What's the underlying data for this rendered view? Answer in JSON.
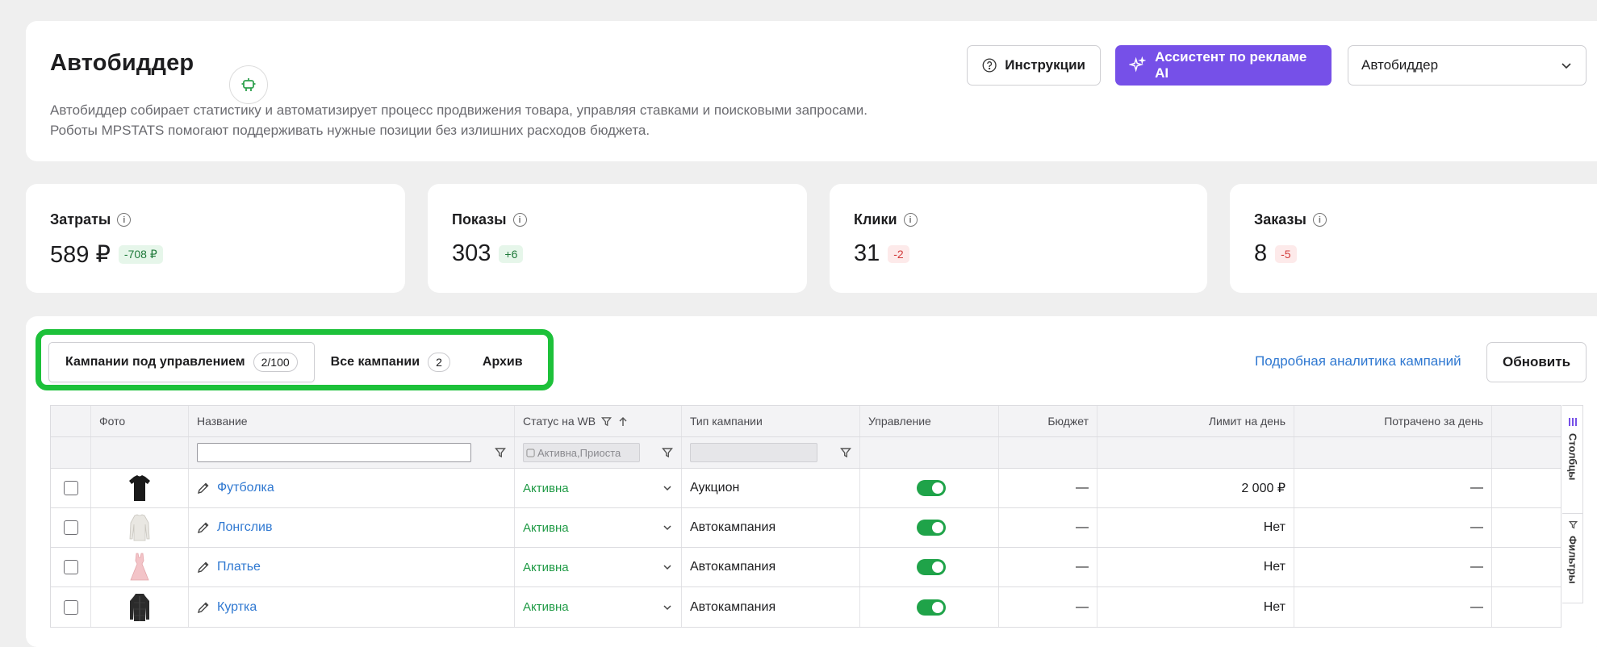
{
  "header": {
    "title": "Автобиддер",
    "description_line1": "Автобиддер собирает статистику и автоматизирует процесс продвижения товара, управляя ставками и поисковыми запросами.",
    "description_line2": "Роботы MPSTATS помогают поддерживать нужные позиции без излишних расходов бюджета.",
    "instructions_label": "Инструкции",
    "ai_label": "Ассистент по рекламе AI",
    "mode_select_value": "Автобиддер"
  },
  "stats": [
    {
      "label": "Затраты",
      "value": "589 ₽",
      "delta": "-708 ₽",
      "delta_kind": "good"
    },
    {
      "label": "Показы",
      "value": "303",
      "delta": "+6",
      "delta_kind": "good"
    },
    {
      "label": "Клики",
      "value": "31",
      "delta": "-2",
      "delta_kind": "bad"
    },
    {
      "label": "Заказы",
      "value": "8",
      "delta": "-5",
      "delta_kind": "bad"
    }
  ],
  "tabs": [
    {
      "label": "Кампании под управлением",
      "count": "2/100"
    },
    {
      "label": "Все кампании",
      "count": "2"
    },
    {
      "label": "Архив",
      "count": ""
    }
  ],
  "analytics_link": "Подробная аналитика кампаний",
  "refresh_label": "Обновить",
  "table": {
    "columns": {
      "foto": "Фото",
      "name": "Название",
      "status": "Статус на WB",
      "type": "Тип кампании",
      "control": "Управление",
      "budget": "Бюджет",
      "limit": "Лимит на день",
      "spent": "Потрачено за день"
    },
    "status_filter_placeholder": "Активна,Приоста",
    "rows": [
      {
        "name": "Футболка",
        "status": "Активна",
        "type": "Аукцион",
        "budget": "—",
        "limit": "2 000 ₽",
        "spent": "—"
      },
      {
        "name": "Лонгслив",
        "status": "Активна",
        "type": "Автокампания",
        "budget": "—",
        "limit": "Нет",
        "spent": "—"
      },
      {
        "name": "Платье",
        "status": "Активна",
        "type": "Автокампания",
        "budget": "—",
        "limit": "Нет",
        "spent": "—"
      },
      {
        "name": "Куртка",
        "status": "Активна",
        "type": "Автокампания",
        "budget": "—",
        "limit": "Нет",
        "spent": "—"
      }
    ]
  },
  "side_panel": {
    "columns_label": "Столбцы",
    "filters_label": "Фильтры"
  },
  "colors": {
    "accent_purple": "#7650e8",
    "link_blue": "#2f78d1",
    "status_green": "#1f9a45",
    "highlight_green": "#1dc13a"
  }
}
